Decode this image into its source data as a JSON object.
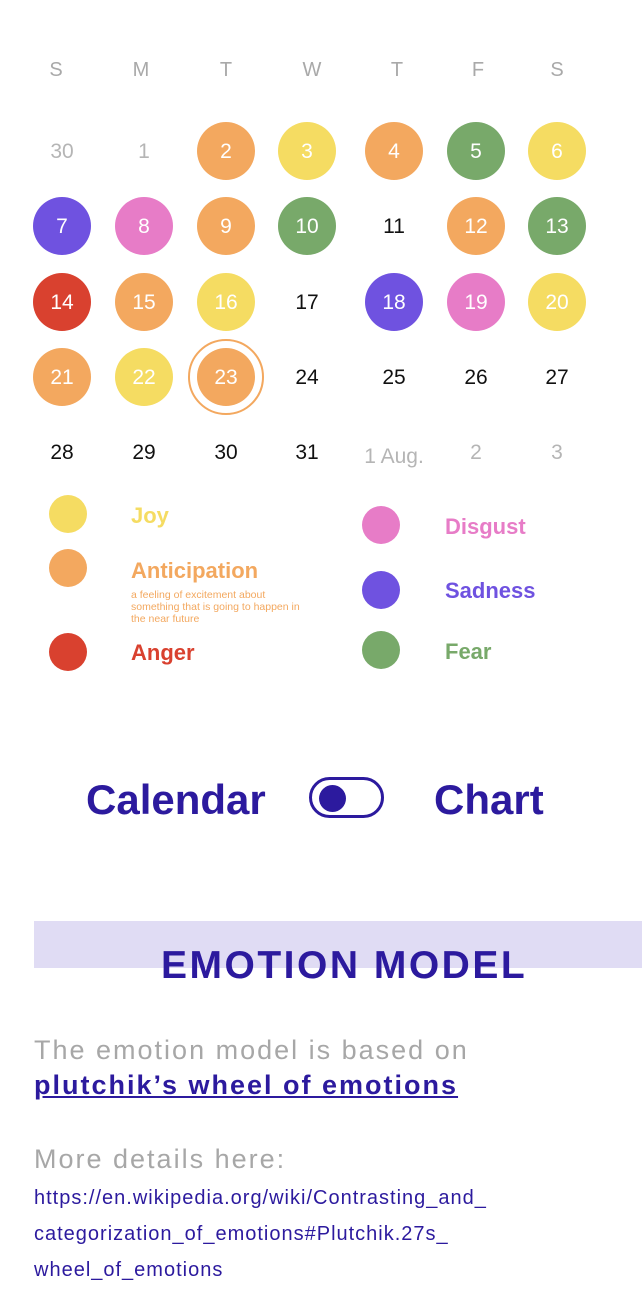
{
  "colors": {
    "joy": "#f5dc62",
    "anticipation": "#f3a85f",
    "anger": "#d9412f",
    "disgust": "#e77cc7",
    "sadness": "#6f52e0",
    "fear": "#78a96a",
    "accent": "#2c1a9e",
    "band": "#e0dcf4"
  },
  "calendar": {
    "weekdays": [
      "S",
      "M",
      "T",
      "W",
      "T",
      "F",
      "S"
    ],
    "weeks": [
      [
        {
          "label": "30",
          "emotion": null,
          "muted": true
        },
        {
          "label": "1",
          "emotion": null,
          "muted": true
        },
        {
          "label": "2",
          "emotion": "anticipation"
        },
        {
          "label": "3",
          "emotion": "joy"
        },
        {
          "label": "4",
          "emotion": "anticipation"
        },
        {
          "label": "5",
          "emotion": "fear"
        },
        {
          "label": "6",
          "emotion": "joy"
        }
      ],
      [
        {
          "label": "7",
          "emotion": "sadness"
        },
        {
          "label": "8",
          "emotion": "disgust"
        },
        {
          "label": "9",
          "emotion": "anticipation"
        },
        {
          "label": "10",
          "emotion": "fear"
        },
        {
          "label": "11",
          "emotion": null
        },
        {
          "label": "12",
          "emotion": "anticipation"
        },
        {
          "label": "13",
          "emotion": "fear"
        }
      ],
      [
        {
          "label": "14",
          "emotion": "anger"
        },
        {
          "label": "15",
          "emotion": "anticipation"
        },
        {
          "label": "16",
          "emotion": "joy"
        },
        {
          "label": "17",
          "emotion": null
        },
        {
          "label": "18",
          "emotion": "sadness"
        },
        {
          "label": "19",
          "emotion": "disgust"
        },
        {
          "label": "20",
          "emotion": "joy"
        }
      ],
      [
        {
          "label": "21",
          "emotion": "anticipation"
        },
        {
          "label": "22",
          "emotion": "joy"
        },
        {
          "label": "23",
          "emotion": "anticipation",
          "today": true
        },
        {
          "label": "24",
          "emotion": null
        },
        {
          "label": "25",
          "emotion": null
        },
        {
          "label": "26",
          "emotion": null
        },
        {
          "label": "27",
          "emotion": null
        }
      ],
      [
        {
          "label": "28",
          "emotion": null
        },
        {
          "label": "29",
          "emotion": null
        },
        {
          "label": "30",
          "emotion": null
        },
        {
          "label": "31",
          "emotion": null
        },
        {
          "label": "1 Aug.",
          "emotion": null,
          "muted": true,
          "aug": true
        },
        {
          "label": "2",
          "emotion": null,
          "muted": true
        },
        {
          "label": "3",
          "emotion": null,
          "muted": true
        }
      ]
    ]
  },
  "legend": {
    "joy": "Joy",
    "anticipation": "Anticipation",
    "anticipation_desc": "a feeling of excitement about something that is going to happen in the near future",
    "anger": "Anger",
    "disgust": "Disgust",
    "sadness": "Sadness",
    "fear": "Fear"
  },
  "toggle": {
    "left_label": "Calendar",
    "right_label": "Chart",
    "active": "Calendar"
  },
  "model": {
    "title": "EMOTION MODEL",
    "text": "The emotion model is based on",
    "link": "plutchik’s wheel of emotions",
    "details_label": "More details here:",
    "url_lines": [
      "https://en.wikipedia.org/wiki/Contrasting_and_",
      "categorization_of_emotions#Plutchik.27s_",
      "wheel_of_emotions"
    ]
  }
}
